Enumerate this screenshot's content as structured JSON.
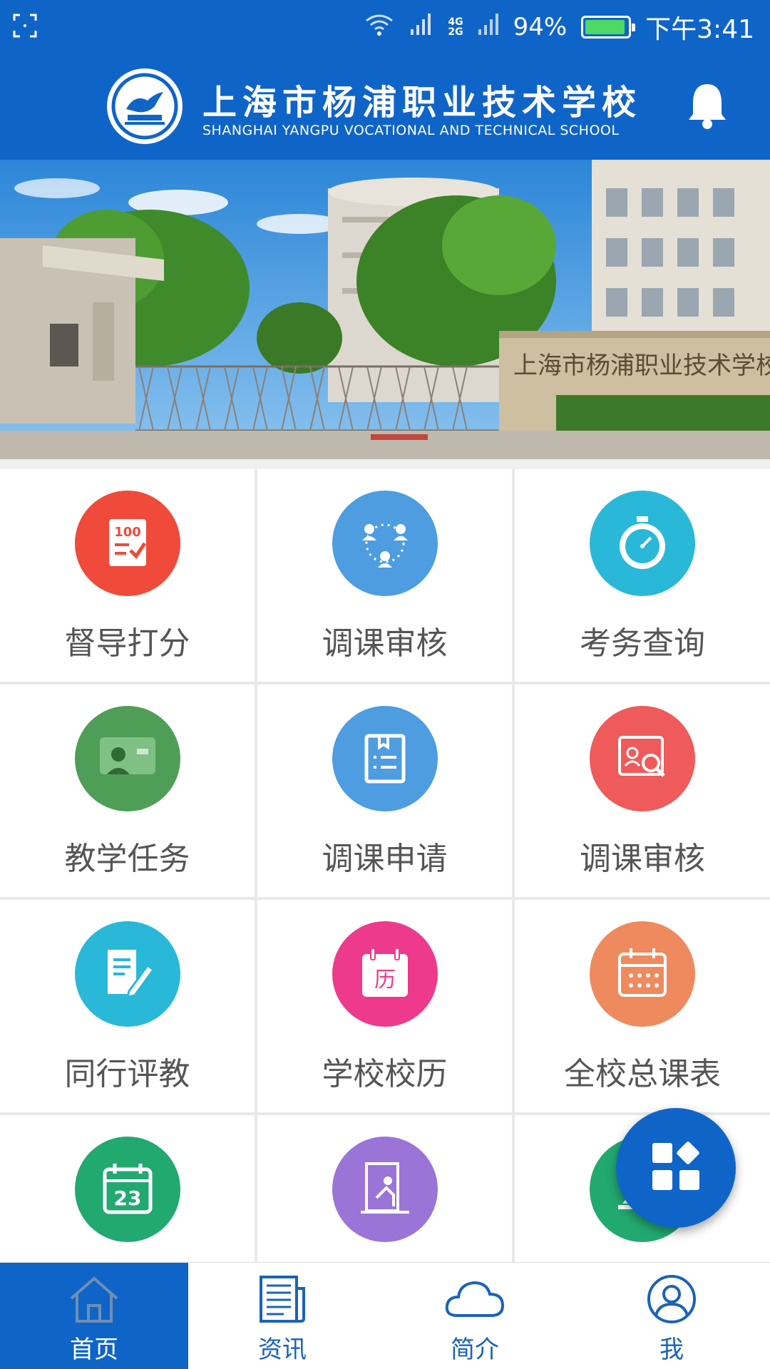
{
  "status_bar": {
    "network_tag_top": "4G",
    "network_tag_bottom": "2G",
    "battery": "94%",
    "battery_level": 0.94,
    "time": "下午3:41"
  },
  "header": {
    "title_cn": "上海市杨浦职业技术学校",
    "title_en": "SHANGHAI YANGPU VOCATIONAL AND TECHNICAL SCHOOL"
  },
  "banner": {
    "gate_sign": "上海市杨浦职业技术学校"
  },
  "grid": [
    {
      "label": "督导打分",
      "color": "#ef4a3a",
      "icon": "score-sheet-icon",
      "icon_text": "100"
    },
    {
      "label": "调课审核",
      "color": "#4d9de0",
      "icon": "group-icon"
    },
    {
      "label": "考务查询",
      "color": "#29b8d8",
      "icon": "stopwatch-icon"
    },
    {
      "label": "教学任务",
      "color": "#4f9e57",
      "icon": "presentation-icon"
    },
    {
      "label": "调课申请",
      "color": "#4d9de0",
      "icon": "book-list-icon"
    },
    {
      "label": "调课审核",
      "color": "#ef5a5a",
      "icon": "profile-search-icon"
    },
    {
      "label": "同行评教",
      "color": "#29b8d8",
      "icon": "edit-document-icon"
    },
    {
      "label": "学校校历",
      "color": "#ee3a8c",
      "icon": "calendar-icon",
      "icon_text": "历"
    },
    {
      "label": "全校总课表",
      "color": "#ef8a5e",
      "icon": "timetable-icon"
    },
    {
      "label": "",
      "color": "#22a970",
      "icon": "date-icon",
      "icon_text": "23"
    },
    {
      "label": "",
      "color": "#9b74d8",
      "icon": "classroom-icon"
    },
    {
      "label": "",
      "color": "#22a970",
      "icon": "meal-icon"
    }
  ],
  "fab": {
    "icon": "apps-icon"
  },
  "bottom_nav": [
    {
      "label": "首页",
      "icon": "home-icon",
      "active": true
    },
    {
      "label": "资讯",
      "icon": "news-icon",
      "active": false
    },
    {
      "label": "简介",
      "icon": "cloud-icon",
      "active": false
    },
    {
      "label": "我",
      "icon": "user-icon",
      "active": false
    }
  ]
}
